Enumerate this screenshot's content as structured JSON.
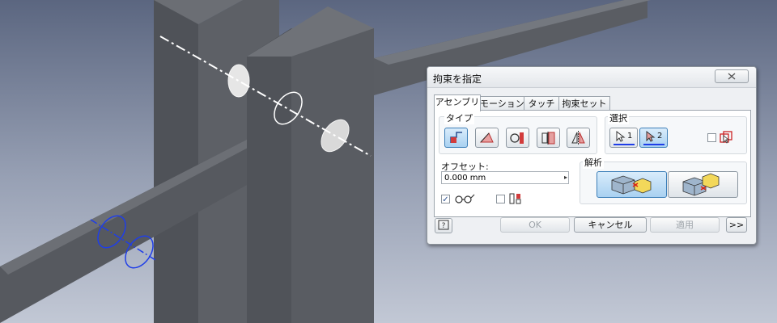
{
  "dialog": {
    "title": "拘束を指定",
    "close_icon": "close-icon",
    "tabs": [
      {
        "label": "アセンブリ",
        "active": true
      },
      {
        "label": "モーション",
        "active": false
      },
      {
        "label": "タッチ",
        "active": false
      },
      {
        "label": "拘束セット",
        "active": false
      }
    ],
    "type_group": {
      "label": "タイプ",
      "buttons": [
        {
          "icon": "mate-constraint-icon",
          "selected": true
        },
        {
          "icon": "angle-constraint-icon",
          "selected": false
        },
        {
          "icon": "tangent-constraint-icon",
          "selected": false
        },
        {
          "icon": "insert-constraint-icon",
          "selected": false
        },
        {
          "icon": "symmetry-constraint-icon",
          "selected": false
        }
      ]
    },
    "selection_group": {
      "label": "選択",
      "select1_label": "1",
      "select2_label": "2",
      "select1_icon": "select-arrow-icon",
      "select2_icon": "select-arrow-icon",
      "first_occurrence_icon": "first-occurrence-icon",
      "first_occurrence_checked": false
    },
    "offset": {
      "label": "オフセット:",
      "value": "0.000 mm",
      "arrow_icon": "chevron-right-icon"
    },
    "preview_checkbox": {
      "checked": true,
      "icon": "glasses-icon"
    },
    "predict_offset_checkbox": {
      "checked": false,
      "icon": "predict-offset-icon"
    },
    "solution_group": {
      "label": "解析",
      "buttons": [
        {
          "icon": "mate-solution-icon",
          "selected": true
        },
        {
          "icon": "flush-solution-icon",
          "selected": false
        }
      ]
    },
    "footer": {
      "help_icon": "help-icon",
      "ok_label": "OK",
      "cancel_label": "キャンセル",
      "apply_label": "適用",
      "more_label": ">>"
    },
    "colors": {
      "accent": "#3d7fb8",
      "selected_fill": "#a9d1f1",
      "highlight_axis": "#1f3ee8"
    }
  }
}
